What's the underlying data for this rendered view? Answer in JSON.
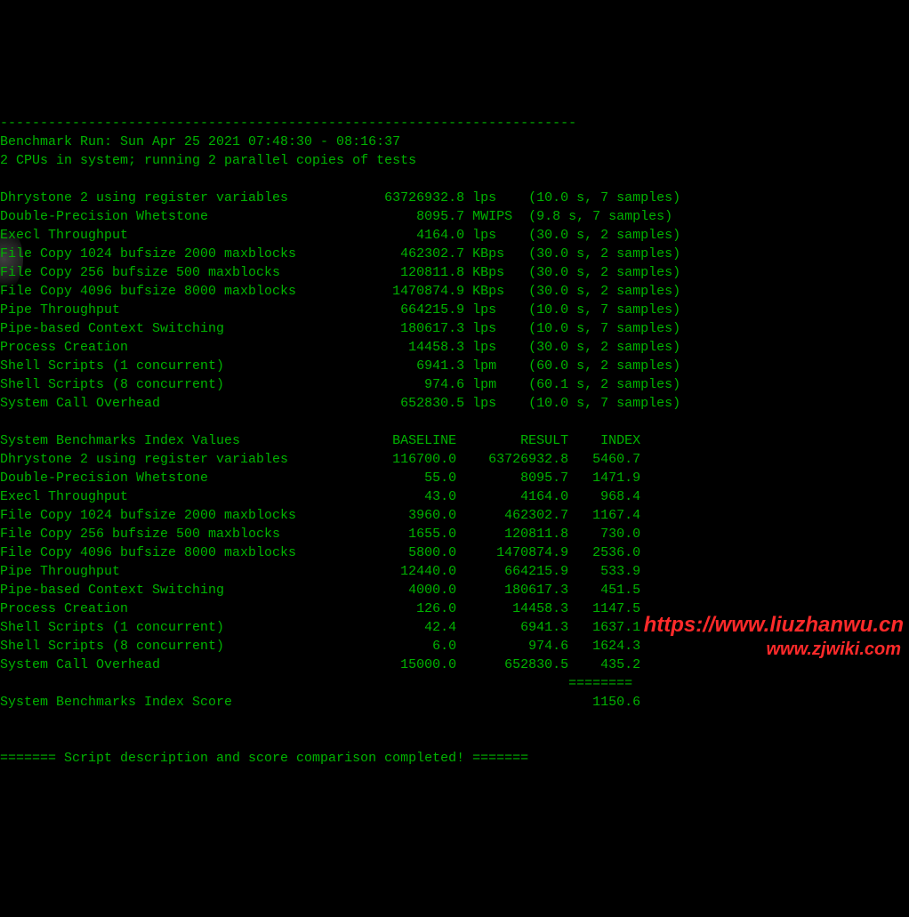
{
  "divider_top": "------------------------------------------------------------------------",
  "run_line": "Benchmark Run: Sun Apr 25 2021 07:48:30 - 08:16:37",
  "cpu_line": "2 CPUs in system; running 2 parallel copies of tests",
  "tests": [
    {
      "name": "Dhrystone 2 using register variables",
      "value": "63726932.8",
      "unit": "lps",
      "time": "10.0",
      "samples": "7"
    },
    {
      "name": "Double-Precision Whetstone",
      "value": "8095.7",
      "unit": "MWIPS",
      "time": "9.8",
      "samples": "7"
    },
    {
      "name": "Execl Throughput",
      "value": "4164.0",
      "unit": "lps",
      "time": "30.0",
      "samples": "2"
    },
    {
      "name": "File Copy 1024 bufsize 2000 maxblocks",
      "value": "462302.7",
      "unit": "KBps",
      "time": "30.0",
      "samples": "2"
    },
    {
      "name": "File Copy 256 bufsize 500 maxblocks",
      "value": "120811.8",
      "unit": "KBps",
      "time": "30.0",
      "samples": "2"
    },
    {
      "name": "File Copy 4096 bufsize 8000 maxblocks",
      "value": "1470874.9",
      "unit": "KBps",
      "time": "30.0",
      "samples": "2"
    },
    {
      "name": "Pipe Throughput",
      "value": "664215.9",
      "unit": "lps",
      "time": "10.0",
      "samples": "7"
    },
    {
      "name": "Pipe-based Context Switching",
      "value": "180617.3",
      "unit": "lps",
      "time": "10.0",
      "samples": "7"
    },
    {
      "name": "Process Creation",
      "value": "14458.3",
      "unit": "lps",
      "time": "30.0",
      "samples": "2"
    },
    {
      "name": "Shell Scripts (1 concurrent)",
      "value": "6941.3",
      "unit": "lpm",
      "time": "60.0",
      "samples": "2"
    },
    {
      "name": "Shell Scripts (8 concurrent)",
      "value": "974.6",
      "unit": "lpm",
      "time": "60.1",
      "samples": "2"
    },
    {
      "name": "System Call Overhead",
      "value": "652830.5",
      "unit": "lps",
      "time": "10.0",
      "samples": "7"
    }
  ],
  "index_header": {
    "label": "System Benchmarks Index Values",
    "baseline": "BASELINE",
    "result": "RESULT",
    "index": "INDEX"
  },
  "indices": [
    {
      "name": "Dhrystone 2 using register variables",
      "baseline": "116700.0",
      "result": "63726932.8",
      "index": "5460.7"
    },
    {
      "name": "Double-Precision Whetstone",
      "baseline": "55.0",
      "result": "8095.7",
      "index": "1471.9"
    },
    {
      "name": "Execl Throughput",
      "baseline": "43.0",
      "result": "4164.0",
      "index": "968.4"
    },
    {
      "name": "File Copy 1024 bufsize 2000 maxblocks",
      "baseline": "3960.0",
      "result": "462302.7",
      "index": "1167.4"
    },
    {
      "name": "File Copy 256 bufsize 500 maxblocks",
      "baseline": "1655.0",
      "result": "120811.8",
      "index": "730.0"
    },
    {
      "name": "File Copy 4096 bufsize 8000 maxblocks",
      "baseline": "5800.0",
      "result": "1470874.9",
      "index": "2536.0"
    },
    {
      "name": "Pipe Throughput",
      "baseline": "12440.0",
      "result": "664215.9",
      "index": "533.9"
    },
    {
      "name": "Pipe-based Context Switching",
      "baseline": "4000.0",
      "result": "180617.3",
      "index": "451.5"
    },
    {
      "name": "Process Creation",
      "baseline": "126.0",
      "result": "14458.3",
      "index": "1147.5"
    },
    {
      "name": "Shell Scripts (1 concurrent)",
      "baseline": "42.4",
      "result": "6941.3",
      "index": "1637.1"
    },
    {
      "name": "Shell Scripts (8 concurrent)",
      "baseline": "6.0",
      "result": "974.6",
      "index": "1624.3"
    },
    {
      "name": "System Call Overhead",
      "baseline": "15000.0",
      "result": "652830.5",
      "index": "435.2"
    }
  ],
  "score_divider": "                                                                   ========",
  "score_line": {
    "label": "System Benchmarks Index Score",
    "value": "1150.6"
  },
  "footer": "======= Script description and score comparison completed! ======= ",
  "watermark1": "https://www.liuzhanwu.cn",
  "watermark2": "www.zjwiki.com"
}
